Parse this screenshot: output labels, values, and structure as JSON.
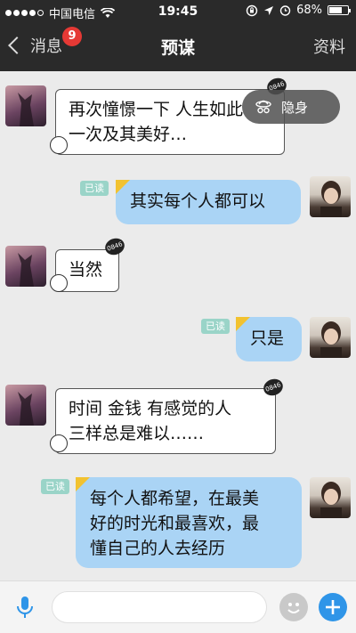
{
  "status_bar": {
    "carrier": "中国电信",
    "time": "19:45",
    "battery": "68%",
    "battery_level": 0.68
  },
  "nav": {
    "back_label": "消息",
    "badge_count": "9",
    "title": "预谋",
    "profile_label": "资料"
  },
  "hide_label": "隐身",
  "messages": [
    {
      "sender": "other",
      "text_lines": [
        "再次憧憬一下 人生如此",
        "一次及其美好…"
      ]
    },
    {
      "sender": "me",
      "read": "已读",
      "text_lines": [
        "其实每个人都可以"
      ]
    },
    {
      "sender": "other",
      "text_lines": [
        "当然"
      ]
    },
    {
      "sender": "me",
      "read": "已读",
      "text_lines": [
        "只是"
      ]
    },
    {
      "sender": "other",
      "text_lines": [
        "时间 金钱 有感觉的人",
        "三样总是难以……"
      ]
    },
    {
      "sender": "me",
      "read": "已读",
      "text_lines": [
        "每个人都希望，在最美",
        "好的时光和最喜欢，最",
        "懂自己的人去经历"
      ]
    }
  ],
  "input": {
    "placeholder": ""
  },
  "colors": {
    "bar_dark": "#2a2a2a",
    "my_bubble": "#aad4f5",
    "read_badge": "#9ad4c8",
    "unread_badge": "#e53935",
    "plus_button": "#2f95e8"
  },
  "icons": [
    "wifi-icon",
    "rotation-lock-icon",
    "location-icon",
    "alarm-icon",
    "battery-icon",
    "back-chevron-icon",
    "incognito-icon",
    "mic-icon",
    "emoji-icon",
    "plus-icon"
  ]
}
